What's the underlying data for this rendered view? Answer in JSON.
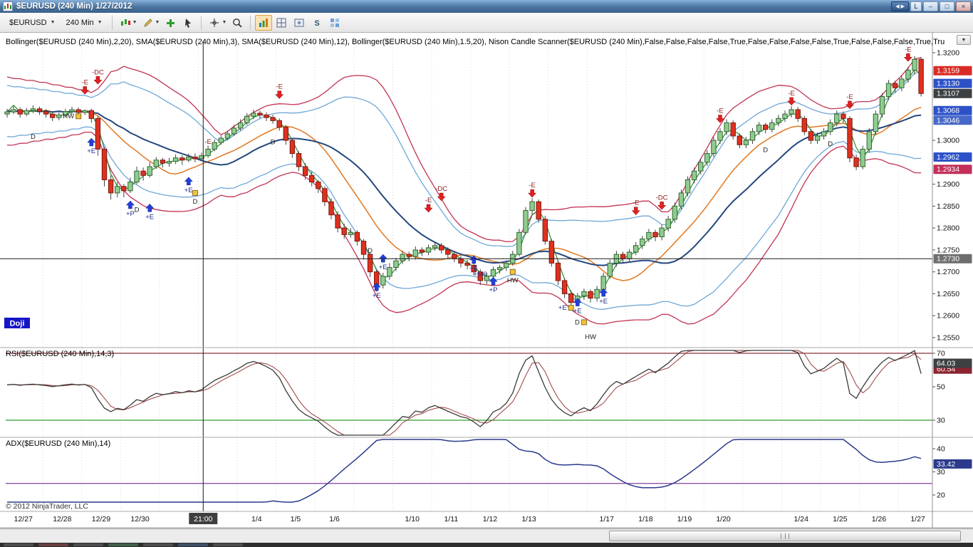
{
  "window": {
    "title": "$EURUSD (240 Min)  1/27/2012",
    "nav_button": "◀ ▶",
    "link_button": "L",
    "minimize": "–",
    "maximize": "□",
    "close": "×"
  },
  "toolbar": {
    "instrument": "$EURUSD",
    "interval": "240 Min"
  },
  "chart": {
    "indicator_header": "Bollinger($EURUSD (240 Min),2,20), SMA($EURUSD (240 Min),3), SMA($EURUSD (240 Min),12), Bollinger($EURUSD (240 Min),1.5,20),  Nison Candle Scanner($EURUSD (240 Min),False,False,False,False,True,False,False,False,False,True,False,False,False,True,Tru",
    "rsi_label": "RSI($EURUSD (240 Min),14,3)",
    "adx_label": "ADX($EURUSD (240 Min),14)",
    "pattern_label": "Doji",
    "copyright": "© 2012 NinjaTrader, LLC"
  },
  "chart_data": {
    "type": "candlestick",
    "instrument": "$EURUSD",
    "interval": "240 Min",
    "session_date": "1/27/2012",
    "bars_per_day": 6,
    "price_axis": {
      "min": 1.255,
      "max": 1.32,
      "plain_ticks": [
        1.32,
        1.3,
        1.29,
        1.285,
        1.28,
        1.275,
        1.27,
        1.265,
        1.26,
        1.255
      ],
      "badges": [
        {
          "value": "1.3159",
          "price": 1.3159,
          "color": "#d92b25"
        },
        {
          "value": "1.3130",
          "price": 1.313,
          "color": "#2d52c8"
        },
        {
          "value": "1.3107",
          "price": 1.3107,
          "color": "#3c4043"
        },
        {
          "value": "1.3068",
          "price": 1.3068,
          "color": "#2d52c8"
        },
        {
          "value": "1.3046",
          "price": 1.3046,
          "color": "#4668c8"
        },
        {
          "value": "1.2962",
          "price": 1.2962,
          "color": "#2d52c8"
        },
        {
          "value": "1.2934",
          "price": 1.2934,
          "color": "#c2305a"
        },
        {
          "value": "1.2730",
          "price": 1.273,
          "color": "#6e6e6e"
        }
      ]
    },
    "x_axis": {
      "labels": [
        {
          "d": 0,
          "t": "12/27"
        },
        {
          "d": 1,
          "t": "12/28"
        },
        {
          "d": 2,
          "t": "12/29"
        },
        {
          "d": 3,
          "t": "12/30"
        },
        {
          "d": 6,
          "t": "1/4"
        },
        {
          "d": 7,
          "t": "1/5"
        },
        {
          "d": 8,
          "t": "1/6"
        },
        {
          "d": 10,
          "t": "1/10"
        },
        {
          "d": 11,
          "t": "1/11"
        },
        {
          "d": 12,
          "t": "1/12"
        },
        {
          "d": 13,
          "t": "1/13"
        },
        {
          "d": 15,
          "t": "1/17"
        },
        {
          "d": 16,
          "t": "1/18"
        },
        {
          "d": 17,
          "t": "1/19"
        },
        {
          "d": 18,
          "t": "1/20"
        },
        {
          "d": 20,
          "t": "1/24"
        },
        {
          "d": 21,
          "t": "1/25"
        },
        {
          "d": 22,
          "t": "1/26"
        },
        {
          "d": 23,
          "t": "1/27"
        }
      ]
    },
    "crosshair": {
      "bar": 30.25,
      "price": 1.273,
      "time_label": "21:00"
    },
    "indicators": {
      "bollinger_2_20_color": "#c23352",
      "bollinger_15_20_color": "#6fa8d8",
      "midband_20_color": "#24477e",
      "sma12_color": "#e07820",
      "sma3_color": "#2e8b2e"
    },
    "rsi_panel": {
      "ticks": [
        70,
        50,
        30
      ],
      "upper_line": 70,
      "lower_line": 30,
      "upper_color": "#8b3038",
      "lower_color": "#2e9e2e",
      "line_color": "#3a3a3a",
      "avg_color": "#9a3a3a",
      "badges": [
        {
          "value": "60.54",
          "v": 60.54,
          "color": "#8b2430"
        },
        {
          "value": "64.03",
          "v": 64.03,
          "color": "#3c4043"
        }
      ]
    },
    "adx_panel": {
      "ticks": [
        40,
        30,
        20
      ],
      "ref_line": 25,
      "ref_color": "#8040a0",
      "line_color": "#2b3a8c",
      "badges": [
        {
          "value": "33.42",
          "v": 33.42,
          "color": "#2b3a8c"
        }
      ]
    },
    "markers": [
      {
        "i": 4,
        "p": 1.3008,
        "t": "D",
        "k": "tx"
      },
      {
        "i": 11,
        "p": 1.3055,
        "t": "HW",
        "k": "sq",
        "s": "l"
      },
      {
        "i": 12,
        "p": 1.3105,
        "t": "-E",
        "k": "da"
      },
      {
        "i": 14,
        "p": 1.3128,
        "t": "-DC",
        "k": "da"
      },
      {
        "i": 13,
        "p": 1.3005,
        "t": "+E",
        "k": "ua"
      },
      {
        "i": 19,
        "p": 1.2862,
        "t": "+P",
        "k": "ua"
      },
      {
        "i": 20,
        "p": 1.2842,
        "t": "D",
        "k": "tx"
      },
      {
        "i": 22,
        "p": 1.2855,
        "t": "+E",
        "k": "ua"
      },
      {
        "i": 28,
        "p": 1.2916,
        "t": "+E",
        "k": "ua"
      },
      {
        "i": 29,
        "p": 1.288,
        "t": "D",
        "k": "sq"
      },
      {
        "i": 31,
        "p": 1.2997,
        "t": "-E",
        "k": "tx"
      },
      {
        "i": 41,
        "p": 1.2996,
        "t": "D",
        "k": "tx"
      },
      {
        "i": 42,
        "p": 1.3095,
        "t": "-E",
        "k": "da"
      },
      {
        "i": 56,
        "p": 1.2748,
        "t": "D",
        "k": "tx"
      },
      {
        "i": 57,
        "p": 1.2675,
        "t": "+E",
        "k": "ua"
      },
      {
        "i": 58,
        "p": 1.274,
        "t": "+E",
        "k": "ua"
      },
      {
        "i": 65,
        "p": 1.2836,
        "t": "-E",
        "k": "da"
      },
      {
        "i": 67,
        "p": 1.2862,
        "t": "-DC",
        "k": "da"
      },
      {
        "i": 72,
        "p": 1.2737,
        "t": "+E",
        "k": "ua"
      },
      {
        "i": 73,
        "p": 1.2695,
        "t": "+MS",
        "k": "tx"
      },
      {
        "i": 75,
        "p": 1.2688,
        "t": "+P",
        "k": "ua"
      },
      {
        "i": 78,
        "p": 1.27,
        "t": "HW",
        "k": "sq"
      },
      {
        "i": 81,
        "p": 1.287,
        "t": "-E",
        "k": "da"
      },
      {
        "i": 87,
        "p": 1.2618,
        "t": "+E",
        "k": "sq",
        "s": "l"
      },
      {
        "i": 88,
        "p": 1.264,
        "t": "+E",
        "k": "ua"
      },
      {
        "i": 89,
        "p": 1.2585,
        "t": "D",
        "k": "sq",
        "s": "l"
      },
      {
        "i": 90,
        "p": 1.2552,
        "t": "HW",
        "k": "tx"
      },
      {
        "i": 92,
        "p": 1.2662,
        "t": "+E",
        "k": "ua"
      },
      {
        "i": 97,
        "p": 1.283,
        "t": "-E",
        "k": "da"
      },
      {
        "i": 101,
        "p": 1.2842,
        "t": "-DC",
        "k": "da"
      },
      {
        "i": 110,
        "p": 1.304,
        "t": "-E",
        "k": "da"
      },
      {
        "i": 117,
        "p": 1.2978,
        "t": "D",
        "k": "tx"
      },
      {
        "i": 121,
        "p": 1.308,
        "t": "-E",
        "k": "da"
      },
      {
        "i": 127,
        "p": 1.2992,
        "t": "D",
        "k": "tx"
      },
      {
        "i": 130,
        "p": 1.3072,
        "t": "-E",
        "k": "da"
      },
      {
        "i": 139,
        "p": 1.318,
        "t": "-E",
        "k": "da"
      }
    ],
    "candles": [
      [
        1.306,
        1.3072,
        1.3052,
        1.3065
      ],
      [
        1.3065,
        1.3078,
        1.306,
        1.307
      ],
      [
        1.307,
        1.3075,
        1.3052,
        1.306
      ],
      [
        1.306,
        1.3074,
        1.3055,
        1.3068
      ],
      [
        1.3068,
        1.308,
        1.3062,
        1.3072
      ],
      [
        1.3072,
        1.3077,
        1.3058,
        1.3066
      ],
      [
        1.3066,
        1.3071,
        1.3052,
        1.306
      ],
      [
        1.306,
        1.3065,
        1.3044,
        1.3052
      ],
      [
        1.3052,
        1.3064,
        1.3046,
        1.3058
      ],
      [
        1.3058,
        1.3072,
        1.3052,
        1.3066
      ],
      [
        1.3066,
        1.3077,
        1.306,
        1.307
      ],
      [
        1.307,
        1.3075,
        1.3056,
        1.3064
      ],
      [
        1.3064,
        1.307,
        1.3058,
        1.3068
      ],
      [
        1.3068,
        1.3072,
        1.304,
        1.305
      ],
      [
        1.305,
        1.3055,
        1.2965,
        1.298
      ],
      [
        1.298,
        1.2985,
        1.2895,
        1.291
      ],
      [
        1.291,
        1.292,
        1.2865,
        1.288
      ],
      [
        1.288,
        1.2905,
        1.287,
        1.2895
      ],
      [
        1.2895,
        1.29,
        1.287,
        1.2885
      ],
      [
        1.2885,
        1.2915,
        1.288,
        1.2905
      ],
      [
        1.2905,
        1.294,
        1.29,
        1.293
      ],
      [
        1.293,
        1.2938,
        1.2908,
        1.292
      ],
      [
        1.292,
        1.295,
        1.2915,
        1.294
      ],
      [
        1.294,
        1.2962,
        1.2935,
        1.2955
      ],
      [
        1.2955,
        1.296,
        1.2938,
        1.2948
      ],
      [
        1.2948,
        1.296,
        1.294,
        1.2952
      ],
      [
        1.2952,
        1.2968,
        1.2946,
        1.296
      ],
      [
        1.296,
        1.2966,
        1.2944,
        1.2955
      ],
      [
        1.2955,
        1.297,
        1.295,
        1.2962
      ],
      [
        1.2962,
        1.297,
        1.295,
        1.2958
      ],
      [
        1.2958,
        1.2972,
        1.2952,
        1.2965
      ],
      [
        1.2965,
        1.2988,
        1.296,
        1.298
      ],
      [
        1.298,
        1.3002,
        1.2975,
        1.2995
      ],
      [
        1.2995,
        1.3012,
        1.299,
        1.3005
      ],
      [
        1.3005,
        1.3022,
        1.3,
        1.3015
      ],
      [
        1.3015,
        1.3035,
        1.301,
        1.3028
      ],
      [
        1.3028,
        1.3048,
        1.3022,
        1.304
      ],
      [
        1.304,
        1.3062,
        1.3035,
        1.3055
      ],
      [
        1.3055,
        1.307,
        1.3048,
        1.3062
      ],
      [
        1.3062,
        1.3068,
        1.305,
        1.3058
      ],
      [
        1.3058,
        1.3064,
        1.3044,
        1.3052
      ],
      [
        1.3052,
        1.3058,
        1.3038,
        1.3045
      ],
      [
        1.3045,
        1.305,
        1.3022,
        1.303
      ],
      [
        1.303,
        1.3035,
        1.299,
        1.3
      ],
      [
        1.3,
        1.3005,
        1.296,
        1.297
      ],
      [
        1.297,
        1.2975,
        1.293,
        1.294
      ],
      [
        1.294,
        1.2948,
        1.291,
        1.292
      ],
      [
        1.292,
        1.293,
        1.2895,
        1.2905
      ],
      [
        1.2905,
        1.291,
        1.288,
        1.289
      ],
      [
        1.289,
        1.2895,
        1.285,
        1.286
      ],
      [
        1.286,
        1.2868,
        1.282,
        1.283
      ],
      [
        1.283,
        1.2838,
        1.279,
        1.28
      ],
      [
        1.28,
        1.281,
        1.2775,
        1.2785
      ],
      [
        1.2785,
        1.28,
        1.2778,
        1.279
      ],
      [
        1.279,
        1.2795,
        1.276,
        1.277
      ],
      [
        1.277,
        1.2775,
        1.2728,
        1.274
      ],
      [
        1.274,
        1.2745,
        1.2688,
        1.27
      ],
      [
        1.27,
        1.2705,
        1.2655,
        1.267
      ],
      [
        1.267,
        1.2698,
        1.2662,
        1.269
      ],
      [
        1.269,
        1.272,
        1.2682,
        1.271
      ],
      [
        1.271,
        1.2732,
        1.2702,
        1.2725
      ],
      [
        1.2725,
        1.2748,
        1.2718,
        1.274
      ],
      [
        1.274,
        1.2746,
        1.2724,
        1.2735
      ],
      [
        1.2735,
        1.2758,
        1.2728,
        1.275
      ],
      [
        1.275,
        1.2756,
        1.2736,
        1.2745
      ],
      [
        1.2745,
        1.2762,
        1.2738,
        1.2755
      ],
      [
        1.2755,
        1.2768,
        1.2748,
        1.276
      ],
      [
        1.276,
        1.2766,
        1.2742,
        1.275
      ],
      [
        1.275,
        1.2756,
        1.273,
        1.274
      ],
      [
        1.274,
        1.2748,
        1.2722,
        1.273
      ],
      [
        1.273,
        1.2736,
        1.271,
        1.272
      ],
      [
        1.272,
        1.2728,
        1.2706,
        1.2715
      ],
      [
        1.2715,
        1.272,
        1.2692,
        1.27
      ],
      [
        1.27,
        1.2706,
        1.267,
        1.268
      ],
      [
        1.268,
        1.2698,
        1.2672,
        1.269
      ],
      [
        1.269,
        1.2712,
        1.2684,
        1.2705
      ],
      [
        1.2705,
        1.2716,
        1.2696,
        1.271
      ],
      [
        1.271,
        1.2726,
        1.2702,
        1.272
      ],
      [
        1.272,
        1.2748,
        1.2714,
        1.274
      ],
      [
        1.274,
        1.2798,
        1.2735,
        1.279
      ],
      [
        1.279,
        1.2848,
        1.2785,
        1.284
      ],
      [
        1.284,
        1.2868,
        1.283,
        1.286
      ],
      [
        1.286,
        1.2865,
        1.2812,
        1.282
      ],
      [
        1.282,
        1.2828,
        1.2762,
        1.277
      ],
      [
        1.277,
        1.2775,
        1.2712,
        1.272
      ],
      [
        1.272,
        1.2726,
        1.267,
        1.268
      ],
      [
        1.268,
        1.2686,
        1.264,
        1.265
      ],
      [
        1.265,
        1.2658,
        1.262,
        1.263
      ],
      [
        1.263,
        1.2652,
        1.2624,
        1.2645
      ],
      [
        1.2645,
        1.2662,
        1.2636,
        1.2655
      ],
      [
        1.2655,
        1.266,
        1.263,
        1.264
      ],
      [
        1.264,
        1.2668,
        1.2632,
        1.266
      ],
      [
        1.266,
        1.2698,
        1.2652,
        1.269
      ],
      [
        1.269,
        1.2728,
        1.2684,
        1.272
      ],
      [
        1.272,
        1.2748,
        1.2712,
        1.274
      ],
      [
        1.274,
        1.2746,
        1.272,
        1.273
      ],
      [
        1.273,
        1.2752,
        1.2722,
        1.2745
      ],
      [
        1.2745,
        1.2768,
        1.2738,
        1.276
      ],
      [
        1.276,
        1.2782,
        1.2752,
        1.2775
      ],
      [
        1.2775,
        1.2798,
        1.2768,
        1.279
      ],
      [
        1.279,
        1.2796,
        1.277,
        1.278
      ],
      [
        1.278,
        1.2808,
        1.2772,
        1.28
      ],
      [
        1.28,
        1.2828,
        1.2792,
        1.282
      ],
      [
        1.282,
        1.2858,
        1.2812,
        1.285
      ],
      [
        1.285,
        1.2888,
        1.2842,
        1.288
      ],
      [
        1.288,
        1.2918,
        1.2872,
        1.291
      ],
      [
        1.291,
        1.2938,
        1.2902,
        1.293
      ],
      [
        1.293,
        1.2958,
        1.2922,
        1.295
      ],
      [
        1.295,
        1.2978,
        1.2942,
        1.297
      ],
      [
        1.297,
        1.3008,
        1.2962,
        1.3
      ],
      [
        1.3,
        1.3028,
        1.2992,
        1.302
      ],
      [
        1.302,
        1.3048,
        1.3012,
        1.304
      ],
      [
        1.304,
        1.3046,
        1.3002,
        1.301
      ],
      [
        1.301,
        1.3016,
        1.2982,
        1.299
      ],
      [
        1.299,
        1.3008,
        1.2982,
        1.3
      ],
      [
        1.3,
        1.3028,
        1.2992,
        1.302
      ],
      [
        1.302,
        1.3042,
        1.3012,
        1.3035
      ],
      [
        1.3035,
        1.304,
        1.3016,
        1.3025
      ],
      [
        1.3025,
        1.3048,
        1.3018,
        1.304
      ],
      [
        1.304,
        1.3058,
        1.3032,
        1.305
      ],
      [
        1.305,
        1.3068,
        1.3042,
        1.306
      ],
      [
        1.306,
        1.3078,
        1.3052,
        1.307
      ],
      [
        1.307,
        1.3076,
        1.3042,
        1.305
      ],
      [
        1.305,
        1.3056,
        1.3012,
        1.302
      ],
      [
        1.302,
        1.3026,
        1.2992,
        1.3
      ],
      [
        1.3,
        1.3018,
        1.2992,
        1.301
      ],
      [
        1.301,
        1.3028,
        1.3002,
        1.302
      ],
      [
        1.302,
        1.3048,
        1.3012,
        1.304
      ],
      [
        1.304,
        1.3068,
        1.3032,
        1.306
      ],
      [
        1.306,
        1.3066,
        1.304,
        1.305
      ],
      [
        1.305,
        1.3055,
        1.295,
        1.296
      ],
      [
        1.296,
        1.2968,
        1.2932,
        1.294
      ],
      [
        1.294,
        1.2988,
        1.2934,
        1.298
      ],
      [
        1.298,
        1.3028,
        1.2972,
        1.302
      ],
      [
        1.302,
        1.3068,
        1.3012,
        1.306
      ],
      [
        1.306,
        1.3108,
        1.3052,
        1.31
      ],
      [
        1.31,
        1.3138,
        1.3092,
        1.313
      ],
      [
        1.313,
        1.3136,
        1.3108,
        1.312
      ],
      [
        1.312,
        1.3148,
        1.3112,
        1.314
      ],
      [
        1.314,
        1.3168,
        1.3132,
        1.316
      ],
      [
        1.316,
        1.3192,
        1.315,
        1.3185
      ],
      [
        1.3185,
        1.319,
        1.31,
        1.3107
      ]
    ]
  }
}
